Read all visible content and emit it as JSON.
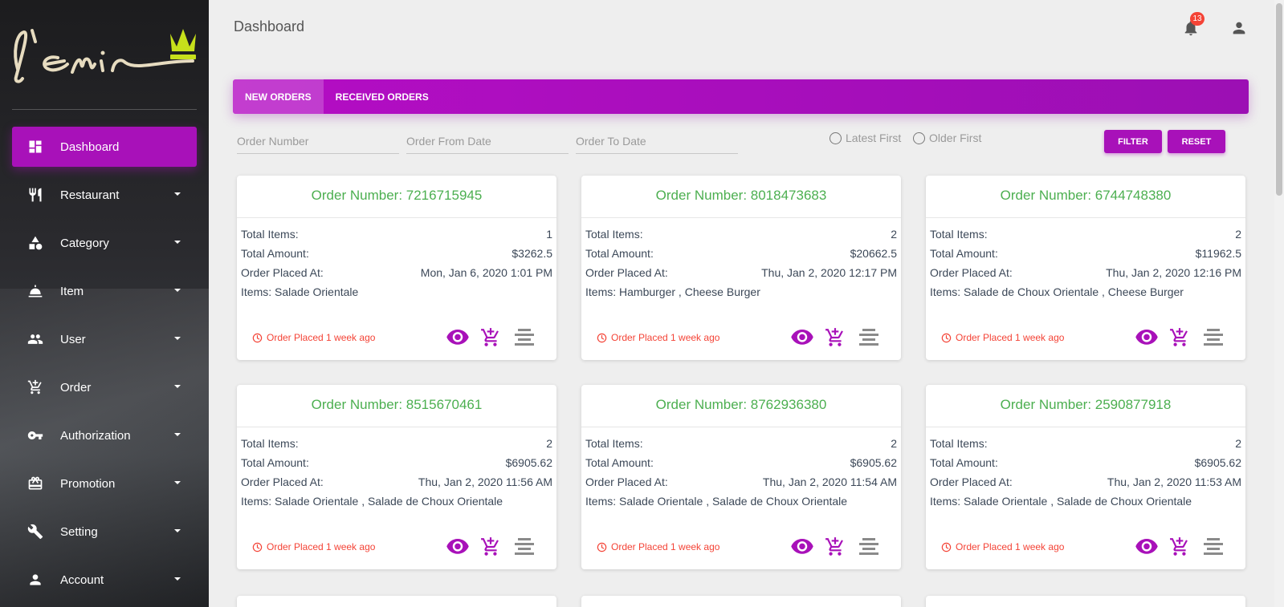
{
  "app": {
    "logo_text": "l'Emir",
    "page_title": "Dashboard"
  },
  "header": {
    "notification_count": "13"
  },
  "sidebar": {
    "items": [
      {
        "label": "Dashboard",
        "icon": "dashboard-icon",
        "active": true
      },
      {
        "label": "Restaurant",
        "icon": "restaurant-icon"
      },
      {
        "label": "Category",
        "icon": "category-icon"
      },
      {
        "label": "Item",
        "icon": "item-icon"
      },
      {
        "label": "User",
        "icon": "users-icon"
      },
      {
        "label": "Order",
        "icon": "cart-icon"
      },
      {
        "label": "Authorization",
        "icon": "key-icon"
      },
      {
        "label": "Promotion",
        "icon": "promotion-icon"
      },
      {
        "label": "Setting",
        "icon": "wrench-icon"
      },
      {
        "label": "Account",
        "icon": "person-icon"
      }
    ]
  },
  "tabs": [
    {
      "label": "NEW ORDERS",
      "active": true
    },
    {
      "label": "RECEIVED ORDERS"
    }
  ],
  "filters": {
    "order_number_placeholder": "Order Number",
    "from_date_placeholder": "Order From Date",
    "to_date_placeholder": "Order To Date",
    "latest_first": "Latest First",
    "older_first": "Older First",
    "filter_label": "FILTER",
    "reset_label": "RESET"
  },
  "labels": {
    "order_number_prefix": "Order Number: ",
    "total_items": "Total Items:",
    "total_amount": "Total Amount:",
    "order_placed_at": "Order Placed At:",
    "items_prefix": "Items: "
  },
  "orders": [
    {
      "number": "7216715945",
      "total_items": "1",
      "total_amount": "$3262.5",
      "placed_at": "Mon, Jan 6, 2020 1:01 PM",
      "items": "Salade Orientale",
      "placed_ago": "Order Placed 1 week ago"
    },
    {
      "number": "8018473683",
      "total_items": "2",
      "total_amount": "$20662.5",
      "placed_at": "Thu, Jan 2, 2020 12:17 PM",
      "items": "Hamburger , Cheese Burger",
      "placed_ago": "Order Placed 1 week ago"
    },
    {
      "number": "6744748380",
      "total_items": "2",
      "total_amount": "$11962.5",
      "placed_at": "Thu, Jan 2, 2020 12:16 PM",
      "items": "Salade de Choux Orientale , Cheese Burger",
      "placed_ago": "Order Placed 1 week ago"
    },
    {
      "number": "8515670461",
      "total_items": "2",
      "total_amount": "$6905.62",
      "placed_at": "Thu, Jan 2, 2020 11:56 AM",
      "items": "Salade Orientale , Salade de Choux Orientale",
      "placed_ago": "Order Placed 1 week ago"
    },
    {
      "number": "8762936380",
      "total_items": "2",
      "total_amount": "$6905.62",
      "placed_at": "Thu, Jan 2, 2020 11:54 AM",
      "items": "Salade Orientale , Salade de Choux Orientale",
      "placed_ago": "Order Placed 1 week ago"
    },
    {
      "number": "2590877918",
      "total_items": "2",
      "total_amount": "$6905.62",
      "placed_at": "Thu, Jan 2, 2020 11:53 AM",
      "items": "Salade Orientale , Salade de Choux Orientale",
      "placed_ago": "Order Placed 1 week ago"
    }
  ],
  "colors": {
    "accent": "#a811b9",
    "order_number": "#4caf50",
    "placed_ago": "#f44336",
    "badge": "#f44336"
  }
}
